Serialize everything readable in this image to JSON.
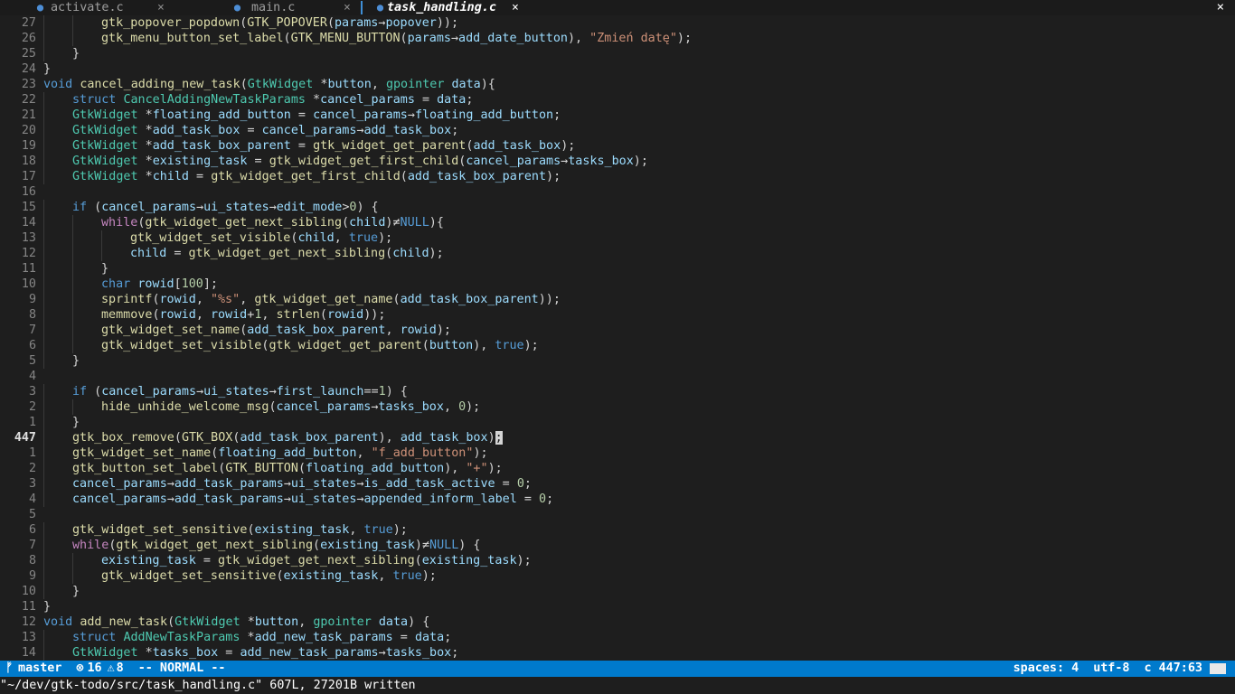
{
  "tabs": [
    {
      "name": "activate.c",
      "icon": "c-file-icon",
      "active": false
    },
    {
      "name": "main.c",
      "icon": "c-file-icon",
      "active": false
    },
    {
      "name": "task_handling.c",
      "icon": "c-file-icon",
      "active": true
    }
  ],
  "close_glyph": "×",
  "code_lines": [
    {
      "n": "27",
      "indent": 2,
      "toks": [
        [
          "gtk_popover_popdown",
          "fn"
        ],
        [
          "(",
          "tx"
        ],
        [
          "GTK_POPOVER",
          "fn"
        ],
        [
          "(",
          "tx"
        ],
        [
          "params",
          "var"
        ],
        [
          "→",
          "op"
        ],
        [
          "popover",
          "var"
        ],
        [
          "));",
          "tx"
        ]
      ]
    },
    {
      "n": "26",
      "indent": 2,
      "toks": [
        [
          "gtk_menu_button_set_label",
          "fn"
        ],
        [
          "(",
          "tx"
        ],
        [
          "GTK_MENU_BUTTON",
          "fn"
        ],
        [
          "(",
          "tx"
        ],
        [
          "params",
          "var"
        ],
        [
          "→",
          "op"
        ],
        [
          "add_date_button",
          "var"
        ],
        [
          "), ",
          "tx"
        ],
        [
          "\"Zmień datę\"",
          "str"
        ],
        [
          ");",
          "tx"
        ]
      ]
    },
    {
      "n": "25",
      "indent": 1,
      "toks": [
        [
          "}",
          "tx"
        ]
      ]
    },
    {
      "n": "24",
      "indent": 0,
      "toks": [
        [
          "}",
          "tx"
        ]
      ]
    },
    {
      "n": "23",
      "indent": 0,
      "toks": [
        [
          "void",
          "kw"
        ],
        [
          " ",
          "tx"
        ],
        [
          "cancel_adding_new_task",
          "fn"
        ],
        [
          "(",
          "tx"
        ],
        [
          "GtkWidget",
          "ty"
        ],
        [
          " *",
          "tx"
        ],
        [
          "button",
          "var"
        ],
        [
          ", ",
          "tx"
        ],
        [
          "gpointer",
          "ty"
        ],
        [
          " ",
          "tx"
        ],
        [
          "data",
          "var"
        ],
        [
          "){",
          "tx"
        ]
      ]
    },
    {
      "n": "22",
      "indent": 1,
      "toks": [
        [
          "struct",
          "kw"
        ],
        [
          " ",
          "tx"
        ],
        [
          "CancelAddingNewTaskParams",
          "ty"
        ],
        [
          " *",
          "tx"
        ],
        [
          "cancel_params",
          "var"
        ],
        [
          " = ",
          "tx"
        ],
        [
          "data",
          "var"
        ],
        [
          ";",
          "tx"
        ]
      ]
    },
    {
      "n": "21",
      "indent": 1,
      "toks": [
        [
          "GtkWidget",
          "ty"
        ],
        [
          " *",
          "tx"
        ],
        [
          "floating_add_button",
          "var"
        ],
        [
          " = ",
          "tx"
        ],
        [
          "cancel_params",
          "var"
        ],
        [
          "→",
          "op"
        ],
        [
          "floating_add_button",
          "var"
        ],
        [
          ";",
          "tx"
        ]
      ]
    },
    {
      "n": "20",
      "indent": 1,
      "toks": [
        [
          "GtkWidget",
          "ty"
        ],
        [
          " *",
          "tx"
        ],
        [
          "add_task_box",
          "var"
        ],
        [
          " = ",
          "tx"
        ],
        [
          "cancel_params",
          "var"
        ],
        [
          "→",
          "op"
        ],
        [
          "add_task_box",
          "var"
        ],
        [
          ";",
          "tx"
        ]
      ]
    },
    {
      "n": "19",
      "indent": 1,
      "toks": [
        [
          "GtkWidget",
          "ty"
        ],
        [
          " *",
          "tx"
        ],
        [
          "add_task_box_parent",
          "var"
        ],
        [
          " = ",
          "tx"
        ],
        [
          "gtk_widget_get_parent",
          "fn"
        ],
        [
          "(",
          "tx"
        ],
        [
          "add_task_box",
          "var"
        ],
        [
          ");",
          "tx"
        ]
      ]
    },
    {
      "n": "18",
      "indent": 1,
      "toks": [
        [
          "GtkWidget",
          "ty"
        ],
        [
          " *",
          "tx"
        ],
        [
          "existing_task",
          "var"
        ],
        [
          " = ",
          "tx"
        ],
        [
          "gtk_widget_get_first_child",
          "fn"
        ],
        [
          "(",
          "tx"
        ],
        [
          "cancel_params",
          "var"
        ],
        [
          "→",
          "op"
        ],
        [
          "tasks_box",
          "var"
        ],
        [
          ");",
          "tx"
        ]
      ]
    },
    {
      "n": "17",
      "indent": 1,
      "toks": [
        [
          "GtkWidget",
          "ty"
        ],
        [
          " *",
          "tx"
        ],
        [
          "child",
          "var"
        ],
        [
          " = ",
          "tx"
        ],
        [
          "gtk_widget_get_first_child",
          "fn"
        ],
        [
          "(",
          "tx"
        ],
        [
          "add_task_box_parent",
          "var"
        ],
        [
          ");",
          "tx"
        ]
      ]
    },
    {
      "n": "16",
      "indent": 0,
      "toks": []
    },
    {
      "n": "15",
      "indent": 1,
      "toks": [
        [
          "if",
          "kw"
        ],
        [
          " (",
          "tx"
        ],
        [
          "cancel_params",
          "var"
        ],
        [
          "→",
          "op"
        ],
        [
          "ui_states",
          "var"
        ],
        [
          "→",
          "op"
        ],
        [
          "edit_mode",
          "var"
        ],
        [
          ">",
          "tx"
        ],
        [
          "0",
          "num"
        ],
        [
          ") {",
          "tx"
        ]
      ]
    },
    {
      "n": "14",
      "indent": 2,
      "toks": [
        [
          "while",
          "ctl"
        ],
        [
          "(",
          "tx"
        ],
        [
          "gtk_widget_get_next_sibling",
          "fn"
        ],
        [
          "(",
          "tx"
        ],
        [
          "child",
          "var"
        ],
        [
          ")",
          "tx"
        ],
        [
          "≠",
          "op"
        ],
        [
          "NULL",
          "kw"
        ],
        [
          "){",
          "tx"
        ]
      ]
    },
    {
      "n": "13",
      "indent": 3,
      "toks": [
        [
          "gtk_widget_set_visible",
          "fn"
        ],
        [
          "(",
          "tx"
        ],
        [
          "child",
          "var"
        ],
        [
          ", ",
          "tx"
        ],
        [
          "true",
          "kw"
        ],
        [
          ");",
          "tx"
        ]
      ]
    },
    {
      "n": "12",
      "indent": 3,
      "toks": [
        [
          "child",
          "var"
        ],
        [
          " = ",
          "tx"
        ],
        [
          "gtk_widget_get_next_sibling",
          "fn"
        ],
        [
          "(",
          "tx"
        ],
        [
          "child",
          "var"
        ],
        [
          ");",
          "tx"
        ]
      ]
    },
    {
      "n": "11",
      "indent": 2,
      "toks": [
        [
          "}",
          "tx"
        ]
      ]
    },
    {
      "n": "10",
      "indent": 2,
      "toks": [
        [
          "char",
          "kw"
        ],
        [
          " ",
          "tx"
        ],
        [
          "rowid",
          "var"
        ],
        [
          "[",
          "tx"
        ],
        [
          "100",
          "num"
        ],
        [
          "];",
          "tx"
        ]
      ]
    },
    {
      "n": "9",
      "indent": 2,
      "toks": [
        [
          "sprintf",
          "fn"
        ],
        [
          "(",
          "tx"
        ],
        [
          "rowid",
          "var"
        ],
        [
          ", ",
          "tx"
        ],
        [
          "\"%s\"",
          "str"
        ],
        [
          ", ",
          "tx"
        ],
        [
          "gtk_widget_get_name",
          "fn"
        ],
        [
          "(",
          "tx"
        ],
        [
          "add_task_box_parent",
          "var"
        ],
        [
          "));",
          "tx"
        ]
      ]
    },
    {
      "n": "8",
      "indent": 2,
      "toks": [
        [
          "memmove",
          "fn"
        ],
        [
          "(",
          "tx"
        ],
        [
          "rowid",
          "var"
        ],
        [
          ", ",
          "tx"
        ],
        [
          "rowid",
          "var"
        ],
        [
          "+",
          "tx"
        ],
        [
          "1",
          "num"
        ],
        [
          ", ",
          "tx"
        ],
        [
          "strlen",
          "fn"
        ],
        [
          "(",
          "tx"
        ],
        [
          "rowid",
          "var"
        ],
        [
          "));",
          "tx"
        ]
      ]
    },
    {
      "n": "7",
      "indent": 2,
      "toks": [
        [
          "gtk_widget_set_name",
          "fn"
        ],
        [
          "(",
          "tx"
        ],
        [
          "add_task_box_parent",
          "var"
        ],
        [
          ", ",
          "tx"
        ],
        [
          "rowid",
          "var"
        ],
        [
          ");",
          "tx"
        ]
      ]
    },
    {
      "n": "6",
      "indent": 2,
      "toks": [
        [
          "gtk_widget_set_visible",
          "fn"
        ],
        [
          "(",
          "tx"
        ],
        [
          "gtk_widget_get_parent",
          "fn"
        ],
        [
          "(",
          "tx"
        ],
        [
          "button",
          "var"
        ],
        [
          "), ",
          "tx"
        ],
        [
          "true",
          "kw"
        ],
        [
          ");",
          "tx"
        ]
      ]
    },
    {
      "n": "5",
      "indent": 1,
      "toks": [
        [
          "}",
          "tx"
        ]
      ]
    },
    {
      "n": "4",
      "indent": 0,
      "toks": []
    },
    {
      "n": "3",
      "indent": 1,
      "toks": [
        [
          "if",
          "kw"
        ],
        [
          " (",
          "tx"
        ],
        [
          "cancel_params",
          "var"
        ],
        [
          "→",
          "op"
        ],
        [
          "ui_states",
          "var"
        ],
        [
          "→",
          "op"
        ],
        [
          "first_launch",
          "var"
        ],
        [
          "==",
          "op"
        ],
        [
          "1",
          "num"
        ],
        [
          ") {",
          "tx"
        ]
      ]
    },
    {
      "n": "2",
      "indent": 2,
      "toks": [
        [
          "hide_unhide_welcome_msg",
          "fn"
        ],
        [
          "(",
          "tx"
        ],
        [
          "cancel_params",
          "var"
        ],
        [
          "→",
          "op"
        ],
        [
          "tasks_box",
          "var"
        ],
        [
          ", ",
          "tx"
        ],
        [
          "0",
          "num"
        ],
        [
          ");",
          "tx"
        ]
      ]
    },
    {
      "n": "1",
      "indent": 1,
      "toks": [
        [
          "}",
          "tx"
        ]
      ]
    },
    {
      "n": "447",
      "indent": 1,
      "current": true,
      "toks": [
        [
          "gtk_box_remove",
          "fn"
        ],
        [
          "(",
          "tx"
        ],
        [
          "GTK_BOX",
          "fn"
        ],
        [
          "(",
          "tx"
        ],
        [
          "add_task_box_parent",
          "var"
        ],
        [
          "), ",
          "tx"
        ],
        [
          "add_task_box",
          "var"
        ],
        [
          ")",
          "tx"
        ],
        [
          ";",
          "cursor"
        ]
      ]
    },
    {
      "n": "1",
      "indent": 1,
      "toks": [
        [
          "gtk_widget_set_name",
          "fn"
        ],
        [
          "(",
          "tx"
        ],
        [
          "floating_add_button",
          "var"
        ],
        [
          ", ",
          "tx"
        ],
        [
          "\"f_add_button\"",
          "str"
        ],
        [
          ");",
          "tx"
        ]
      ]
    },
    {
      "n": "2",
      "indent": 1,
      "toks": [
        [
          "gtk_button_set_label",
          "fn"
        ],
        [
          "(",
          "tx"
        ],
        [
          "GTK_BUTTON",
          "fn"
        ],
        [
          "(",
          "tx"
        ],
        [
          "floating_add_button",
          "var"
        ],
        [
          "), ",
          "tx"
        ],
        [
          "\"+\"",
          "str"
        ],
        [
          ");",
          "tx"
        ]
      ]
    },
    {
      "n": "3",
      "indent": 1,
      "toks": [
        [
          "cancel_params",
          "var"
        ],
        [
          "→",
          "op"
        ],
        [
          "add_task_params",
          "var"
        ],
        [
          "→",
          "op"
        ],
        [
          "ui_states",
          "var"
        ],
        [
          "→",
          "op"
        ],
        [
          "is_add_task_active",
          "var"
        ],
        [
          " = ",
          "tx"
        ],
        [
          "0",
          "num"
        ],
        [
          ";",
          "tx"
        ]
      ]
    },
    {
      "n": "4",
      "indent": 1,
      "toks": [
        [
          "cancel_params",
          "var"
        ],
        [
          "→",
          "op"
        ],
        [
          "add_task_params",
          "var"
        ],
        [
          "→",
          "op"
        ],
        [
          "ui_states",
          "var"
        ],
        [
          "→",
          "op"
        ],
        [
          "appended_inform_label",
          "var"
        ],
        [
          " = ",
          "tx"
        ],
        [
          "0",
          "num"
        ],
        [
          ";",
          "tx"
        ]
      ]
    },
    {
      "n": "5",
      "indent": 0,
      "toks": []
    },
    {
      "n": "6",
      "indent": 1,
      "toks": [
        [
          "gtk_widget_set_sensitive",
          "fn"
        ],
        [
          "(",
          "tx"
        ],
        [
          "existing_task",
          "var"
        ],
        [
          ", ",
          "tx"
        ],
        [
          "true",
          "kw"
        ],
        [
          ");",
          "tx"
        ]
      ]
    },
    {
      "n": "7",
      "indent": 1,
      "toks": [
        [
          "while",
          "ctl"
        ],
        [
          "(",
          "tx"
        ],
        [
          "gtk_widget_get_next_sibling",
          "fn"
        ],
        [
          "(",
          "tx"
        ],
        [
          "existing_task",
          "var"
        ],
        [
          ")",
          "tx"
        ],
        [
          "≠",
          "op"
        ],
        [
          "NULL",
          "kw"
        ],
        [
          ") {",
          "tx"
        ]
      ]
    },
    {
      "n": "8",
      "indent": 2,
      "toks": [
        [
          "existing_task",
          "var"
        ],
        [
          " = ",
          "tx"
        ],
        [
          "gtk_widget_get_next_sibling",
          "fn"
        ],
        [
          "(",
          "tx"
        ],
        [
          "existing_task",
          "var"
        ],
        [
          ");",
          "tx"
        ]
      ]
    },
    {
      "n": "9",
      "indent": 2,
      "toks": [
        [
          "gtk_widget_set_sensitive",
          "fn"
        ],
        [
          "(",
          "tx"
        ],
        [
          "existing_task",
          "var"
        ],
        [
          ", ",
          "tx"
        ],
        [
          "true",
          "kw"
        ],
        [
          ");",
          "tx"
        ]
      ]
    },
    {
      "n": "10",
      "indent": 1,
      "toks": [
        [
          "}",
          "tx"
        ]
      ]
    },
    {
      "n": "11",
      "indent": 0,
      "toks": [
        [
          "}",
          "tx"
        ]
      ]
    },
    {
      "n": "12",
      "indent": 0,
      "toks": [
        [
          "void",
          "kw"
        ],
        [
          " ",
          "tx"
        ],
        [
          "add_new_task",
          "fn"
        ],
        [
          "(",
          "tx"
        ],
        [
          "GtkWidget",
          "ty"
        ],
        [
          " *",
          "tx"
        ],
        [
          "button",
          "var"
        ],
        [
          ", ",
          "tx"
        ],
        [
          "gpointer",
          "ty"
        ],
        [
          " ",
          "tx"
        ],
        [
          "data",
          "var"
        ],
        [
          ") {",
          "tx"
        ]
      ]
    },
    {
      "n": "13",
      "indent": 1,
      "toks": [
        [
          "struct",
          "kw"
        ],
        [
          " ",
          "tx"
        ],
        [
          "AddNewTaskParams",
          "ty"
        ],
        [
          " *",
          "tx"
        ],
        [
          "add_new_task_params",
          "var"
        ],
        [
          " = ",
          "tx"
        ],
        [
          "data",
          "var"
        ],
        [
          ";",
          "tx"
        ]
      ]
    },
    {
      "n": "14",
      "indent": 1,
      "toks": [
        [
          "GtkWidget",
          "ty"
        ],
        [
          " *",
          "tx"
        ],
        [
          "tasks_box",
          "var"
        ],
        [
          " = ",
          "tx"
        ],
        [
          "add_new_task_params",
          "var"
        ],
        [
          "→",
          "op"
        ],
        [
          "tasks_box",
          "var"
        ],
        [
          ";",
          "tx"
        ]
      ]
    }
  ],
  "statusbar": {
    "branch_icon": "git-branch-icon",
    "branch": "master",
    "error_icon": "error-icon",
    "errors": "16",
    "warning_icon": "warning-icon",
    "warnings": "8",
    "mode": "-- NORMAL --",
    "indent": "spaces: 4",
    "encoding": "utf-8",
    "position": "c 447:63"
  },
  "cmdline": "\"~/dev/gtk-todo/src/task_handling.c\" 607L, 27201B written",
  "colors": {
    "statusbar_bg": "#007acc",
    "editor_bg": "#1e1e1e",
    "tab_separator": "#3f8fd6"
  }
}
